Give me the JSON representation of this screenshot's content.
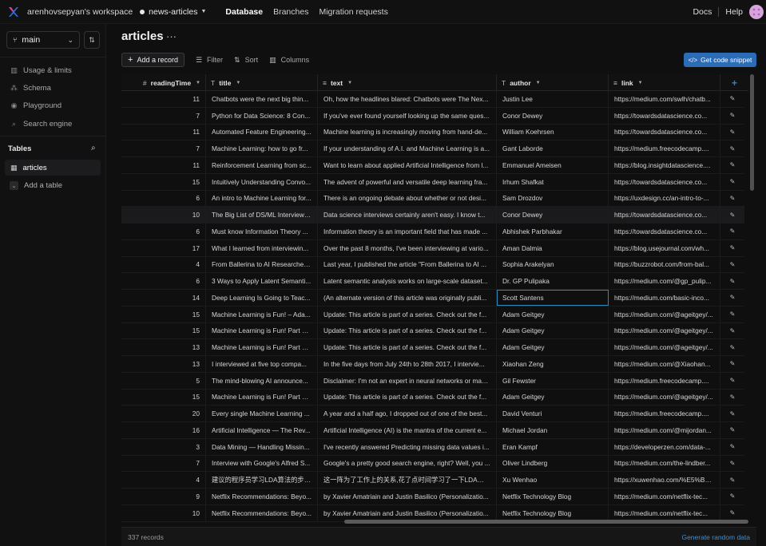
{
  "topbar": {
    "workspace": "arenhovsepyan's workspace",
    "database": "news-articles",
    "nav": [
      "Database",
      "Branches",
      "Migration requests"
    ],
    "active_nav": "Database",
    "docs": "Docs",
    "help": "Help"
  },
  "sidebar": {
    "branch": "main",
    "items": [
      {
        "icon": "chart-icon",
        "label": "Usage & limits"
      },
      {
        "icon": "schema-icon",
        "label": "Schema"
      },
      {
        "icon": "playground-icon",
        "label": "Playground"
      },
      {
        "icon": "search-engine-icon",
        "label": "Search engine"
      }
    ],
    "tables_heading": "Tables",
    "table_name": "articles",
    "add_table": "Add a table"
  },
  "main": {
    "title": "articles",
    "title_more": "···",
    "toolbar": {
      "add_record": "Add a record",
      "filter": "Filter",
      "sort": "Sort",
      "columns": "Columns",
      "get_snippet": "Get code snippet"
    },
    "columns": [
      {
        "type": "#",
        "name": "readingTime"
      },
      {
        "type": "T",
        "name": "title"
      },
      {
        "type": "≡",
        "name": "text"
      },
      {
        "type": "T",
        "name": "author"
      },
      {
        "type": "≡",
        "name": "link"
      }
    ],
    "rows": [
      [
        "11",
        "Chatbots were the next big thin...",
        "Oh, how the headlines blared: Chatbots were The Nex...",
        "Justin Lee",
        "https://medium.com/swlh/chatb..."
      ],
      [
        "7",
        "Python for Data Science: 8 Con...",
        "If you've ever found yourself looking up the same ques...",
        "Conor Dewey",
        "https://towardsdatascience.co..."
      ],
      [
        "11",
        "Automated Feature Engineering...",
        "Machine learning is increasingly moving from hand-de...",
        "William Koehrsen",
        "https://towardsdatascience.co..."
      ],
      [
        "7",
        "Machine Learning: how to go fr...",
        "If your understanding of A.I. and Machine Learning is a...",
        "Gant Laborde",
        "https://medium.freecodecamp...."
      ],
      [
        "11",
        "Reinforcement Learning from sc...",
        "Want to learn about applied Artificial Intelligence from l...",
        "Emmanuel Ameisen",
        "https://blog.insightdatascience...."
      ],
      [
        "15",
        "Intuitively Understanding Convo...",
        "The advent of powerful and versatile deep learning fra...",
        "Irhum Shafkat",
        "https://towardsdatascience.co..."
      ],
      [
        "6",
        "An intro to Machine Learning for...",
        "There is an ongoing debate about whether or not desi...",
        "Sam Drozdov",
        "https://uxdesign.cc/an-intro-to-..."
      ],
      [
        "10",
        "The Big List of DS/ML Interview ...",
        "Data science interviews certainly aren't easy. I know t...",
        "Conor Dewey",
        "https://towardsdatascience.co..."
      ],
      [
        "6",
        "Must know Information Theory ...",
        "Information theory is an important field that has made ...",
        "Abhishek Parbhakar",
        "https://towardsdatascience.co..."
      ],
      [
        "17",
        "What I learned from interviewin...",
        "Over the past 8 months, I've been interviewing at vario...",
        "Aman Dalmia",
        "https://blog.usejournal.com/wh..."
      ],
      [
        "4",
        "From Ballerina to AI Researcher:...",
        "Last year, I published the article \"From Ballerina to AI ...",
        "Sophia Arakelyan",
        "https://buzzrobot.com/from-bal..."
      ],
      [
        "6",
        "3 Ways to Apply Latent Semanti...",
        "Latent semantic analysis works on large-scale dataset...",
        "Dr. GP Pulipaka",
        "https://medium.com/@gp_pulip..."
      ],
      [
        "14",
        "Deep Learning Is Going to Teac...",
        "(An alternate version of this article was originally publi...",
        "Scott Santens",
        "https://medium.com/basic-inco..."
      ],
      [
        "15",
        "Machine Learning is Fun! – Ada...",
        "Update: This article is part of a series. Check out the f...",
        "Adam Geitgey",
        "https://medium.com/@ageitgey/..."
      ],
      [
        "15",
        "Machine Learning is Fun! Part 3:...",
        "Update: This article is part of a series. Check out the f...",
        "Adam Geitgey",
        "https://medium.com/@ageitgey/..."
      ],
      [
        "13",
        "Machine Learning is Fun! Part 4:...",
        "Update: This article is part of a series. Check out the f...",
        "Adam Geitgey",
        "https://medium.com/@ageitgey/..."
      ],
      [
        "13",
        "I interviewed at five top compa...",
        "In the five days from July 24th to 28th 2017, I intervie...",
        "Xiaohan Zeng",
        "https://medium.com/@Xiaohan..."
      ],
      [
        "5",
        "The mind-blowing AI announce...",
        "Disclaimer: I'm not an expert in neural networks or mac...",
        "Gil Fewster",
        "https://medium.freecodecamp...."
      ],
      [
        "15",
        "Machine Learning is Fun! Part 2 ...",
        "Update: This article is part of a series. Check out the f...",
        "Adam Geitgey",
        "https://medium.com/@ageitgey/..."
      ],
      [
        "20",
        "Every single Machine Learning ...",
        "A year and a half ago, I dropped out of one of the best...",
        "David Venturi",
        "https://medium.freecodecamp...."
      ],
      [
        "16",
        "Artificial Intelligence — The Rev...",
        "Artificial Intelligence (AI) is the mantra of the current e...",
        "Michael Jordan",
        "https://medium.com/@mijordan..."
      ],
      [
        "3",
        "Data Mining — Handling Missin...",
        "I've recently answered Predicting missing data values i...",
        "Eran Kampf",
        "https://developerzen.com/data-..."
      ],
      [
        "7",
        "Interview with Google's Alfred S...",
        "Google's a pretty good search engine, right? Well, you ...",
        "Oliver Lindberg",
        "https://medium.com/the-lindber..."
      ],
      [
        "4",
        "建议的程序员学习LDA算法的步骤...",
        "这一阵为了工作上的关系,花了点时间学习了一下LDA算法,...",
        "Xu Wenhao",
        "https://xuwenhao.com/%E5%BB..."
      ],
      [
        "9",
        "Netflix Recommendations: Beyo...",
        "by Xavier Amatriain and Justin Basilico (Personalizatio...",
        "Netflix Technology Blog",
        "https://medium.com/netflix-tec..."
      ],
      [
        "10",
        "Netflix Recommendations: Beyo...",
        "by Xavier Amatriain and Justin Basilico (Personalizatio...",
        "Netflix Technology Blog",
        "https://medium.com/netflix-tec..."
      ]
    ],
    "record_count": "337 records",
    "generate": "Generate random data"
  }
}
